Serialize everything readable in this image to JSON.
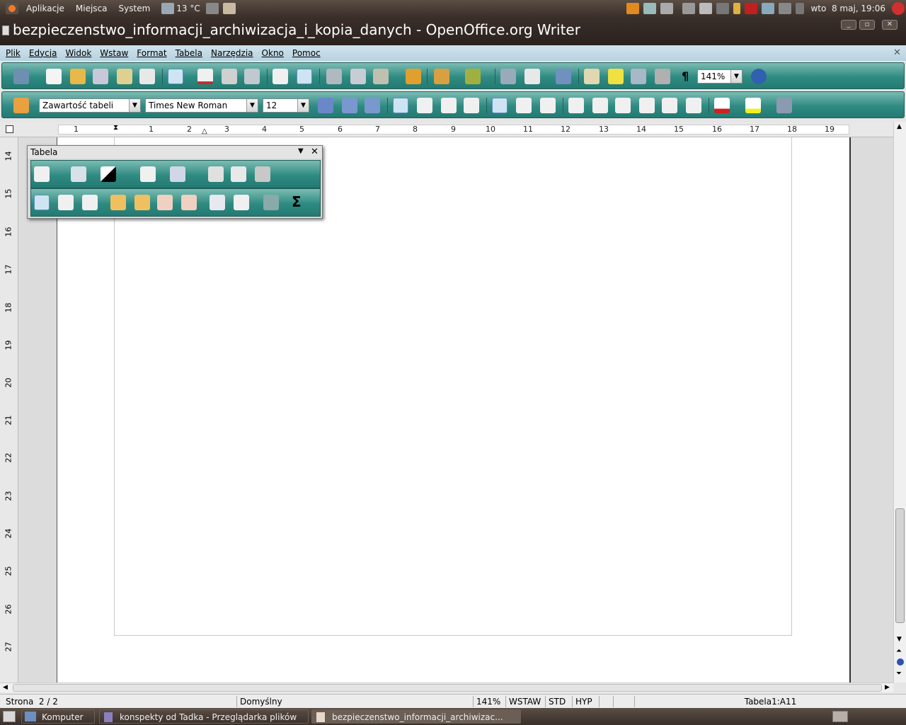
{
  "top_panel": {
    "menus": [
      "Aplikacje",
      "Miejsca",
      "System"
    ],
    "weather": "13 °C",
    "clock": "wto  8 maj, 19:06"
  },
  "window": {
    "title": "bezpieczenstwo_informacji_archiwizacja_i_kopia_danych - OpenOffice.org Writer"
  },
  "menubar": {
    "items": [
      "Plik",
      "Edycja",
      "Widok",
      "Wstaw",
      "Format",
      "Tabela",
      "Narzędzia",
      "Okno",
      "Pomoc"
    ]
  },
  "standard_toolbar": {
    "zoom": "141%"
  },
  "format_toolbar": {
    "style": "Zawartość tabeli",
    "font": "Times New Roman",
    "size": "12"
  },
  "ruler": {
    "numbers": [
      "1",
      "1",
      "2",
      "3",
      "4",
      "5",
      "6",
      "7",
      "8",
      "9",
      "10",
      "11",
      "12",
      "13",
      "14",
      "15",
      "16",
      "17",
      "18",
      "19"
    ],
    "vertical_numbers": [
      "14",
      "15",
      "16",
      "17",
      "18",
      "19",
      "20",
      "21",
      "22",
      "23",
      "24",
      "25",
      "26",
      "27"
    ]
  },
  "table_toolbar": {
    "title": "Tabela"
  },
  "statusbar": {
    "page": "Strona  2 / 2",
    "style": "Domyślny",
    "zoom": "141%",
    "insert_mode": "WSTAW",
    "selection_mode": "STD",
    "hyperlink_mode": "HYP",
    "cell": "Tabela1:A11"
  },
  "taskbar": {
    "tasks": [
      "Komputer",
      "konspekty od Tadka - Przeglądarka plików",
      "bezpieczenstwo_informacji_archiwizac..."
    ]
  },
  "colors": {
    "toolbar": "#2f8b82",
    "panel": "#3a2f29"
  }
}
